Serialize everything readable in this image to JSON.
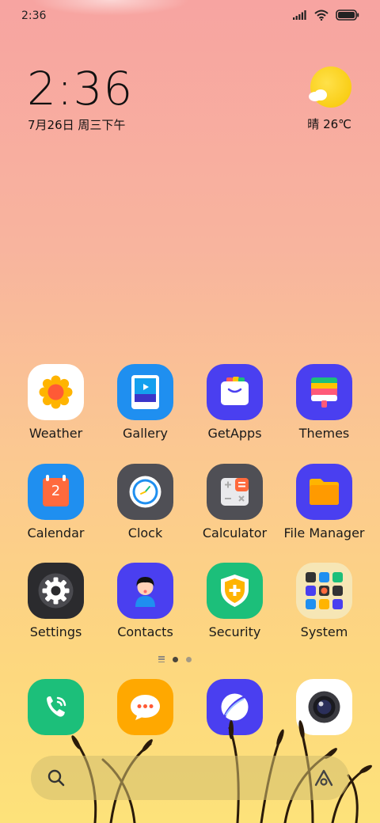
{
  "status_bar": {
    "time": "2:36"
  },
  "clock_widget": {
    "time": "2:36",
    "date": "7月26日 周三下午"
  },
  "weather_widget": {
    "text": "晴 26℃"
  },
  "apps": [
    {
      "label": "Weather"
    },
    {
      "label": "Gallery"
    },
    {
      "label": "GetApps"
    },
    {
      "label": "Themes"
    },
    {
      "label": "Calendar",
      "badge": "2"
    },
    {
      "label": "Clock"
    },
    {
      "label": "Calculator"
    },
    {
      "label": "File Manager"
    },
    {
      "label": "Settings"
    },
    {
      "label": "Contacts"
    },
    {
      "label": "Security"
    },
    {
      "label": "System"
    }
  ],
  "dock": [
    {
      "icon": "phone-icon"
    },
    {
      "icon": "messages-icon"
    },
    {
      "icon": "browser-icon"
    },
    {
      "icon": "camera-icon"
    }
  ],
  "page_indicator": {
    "pages": 2,
    "active": 1
  },
  "colors": {
    "weather_bg": "#ffffff",
    "gallery_bg": "#1f8ff0",
    "getapps_bg": "#4a3ff0",
    "themes_bg": "#4a3ff0",
    "calendar_bg": "#1f8ff0",
    "clock_bg": "#4f4f55",
    "calculator_bg": "#4f4f55",
    "filemanager_bg": "#4a3ff0",
    "settings_bg": "#2b2b2e",
    "contacts_bg": "#4a3ff0",
    "security_bg": "#1cbf7a",
    "phone_bg": "#1cbf7a",
    "messages_bg": "#ffa800",
    "browser_bg": "#4a3ff0",
    "camera_bg": "#ffffff"
  }
}
